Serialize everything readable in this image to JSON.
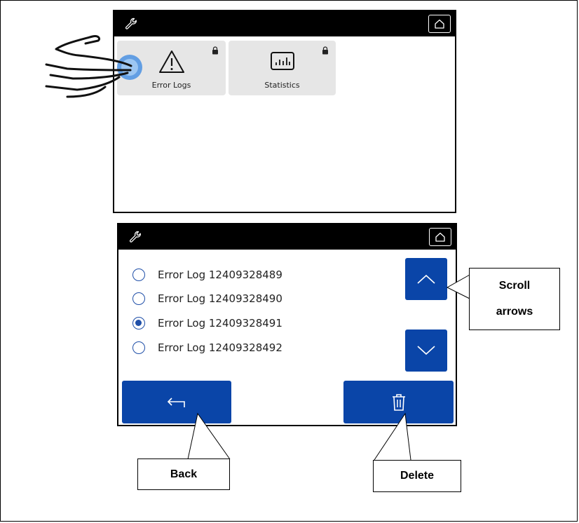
{
  "top_screen": {
    "tiles": [
      {
        "label": "Error Logs",
        "icon": "warning-icon"
      },
      {
        "label": "Statistics",
        "icon": "statistics-icon"
      }
    ]
  },
  "bottom_screen": {
    "error_logs": [
      {
        "label": "Error Log 12409328489",
        "selected": false
      },
      {
        "label": "Error Log 12409328490",
        "selected": false
      },
      {
        "label": "Error Log 12409328491",
        "selected": true
      },
      {
        "label": "Error Log 12409328492",
        "selected": false
      }
    ]
  },
  "callouts": {
    "scroll_line1": "Scroll",
    "scroll_line2": "arrows",
    "back": "Back",
    "delete": "Delete"
  },
  "colors": {
    "accent": "#0a45a8",
    "tile_bg": "#e6e6e6",
    "bar": "#000000"
  }
}
